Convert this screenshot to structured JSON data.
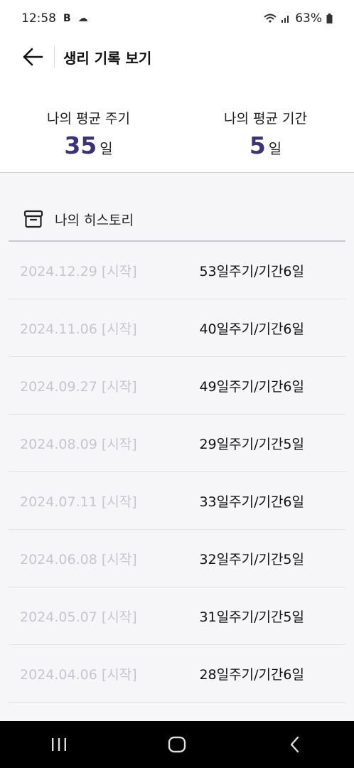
{
  "status_bar": {
    "time": "12:58",
    "badge": "B",
    "battery": "63%"
  },
  "header": {
    "title": "생리 기록 보기"
  },
  "summary": {
    "cycle_label": "나의 평균 주기",
    "cycle_value": "35",
    "cycle_unit": "일",
    "period_label": "나의 평균 기간",
    "period_value": "5",
    "period_unit": "일"
  },
  "history": {
    "title": "나의 히스토리",
    "rows": [
      {
        "date": "2024.12.29 [시작]",
        "summary": "53일주기/기간6일"
      },
      {
        "date": "2024.11.06 [시작]",
        "summary": "40일주기/기간6일"
      },
      {
        "date": "2024.09.27 [시작]",
        "summary": "49일주기/기간6일"
      },
      {
        "date": "2024.08.09 [시작]",
        "summary": "29일주기/기간5일"
      },
      {
        "date": "2024.07.11 [시작]",
        "summary": "33일주기/기간6일"
      },
      {
        "date": "2024.06.08 [시작]",
        "summary": "32일주기/기간5일"
      },
      {
        "date": "2024.05.07 [시작]",
        "summary": "31일주기/기간5일"
      },
      {
        "date": "2024.04.06 [시작]",
        "summary": "28일주기/기간6일"
      }
    ]
  },
  "colors": {
    "accent": "#3c3472",
    "history_bg": "#f6f6f8",
    "date_text": "#c6c6ce"
  },
  "icons": {
    "back": "arrow-left-icon",
    "history": "archive-box-icon",
    "nav_recent": "recent-apps-icon",
    "nav_home": "home-icon",
    "nav_back": "back-chevron-icon"
  }
}
